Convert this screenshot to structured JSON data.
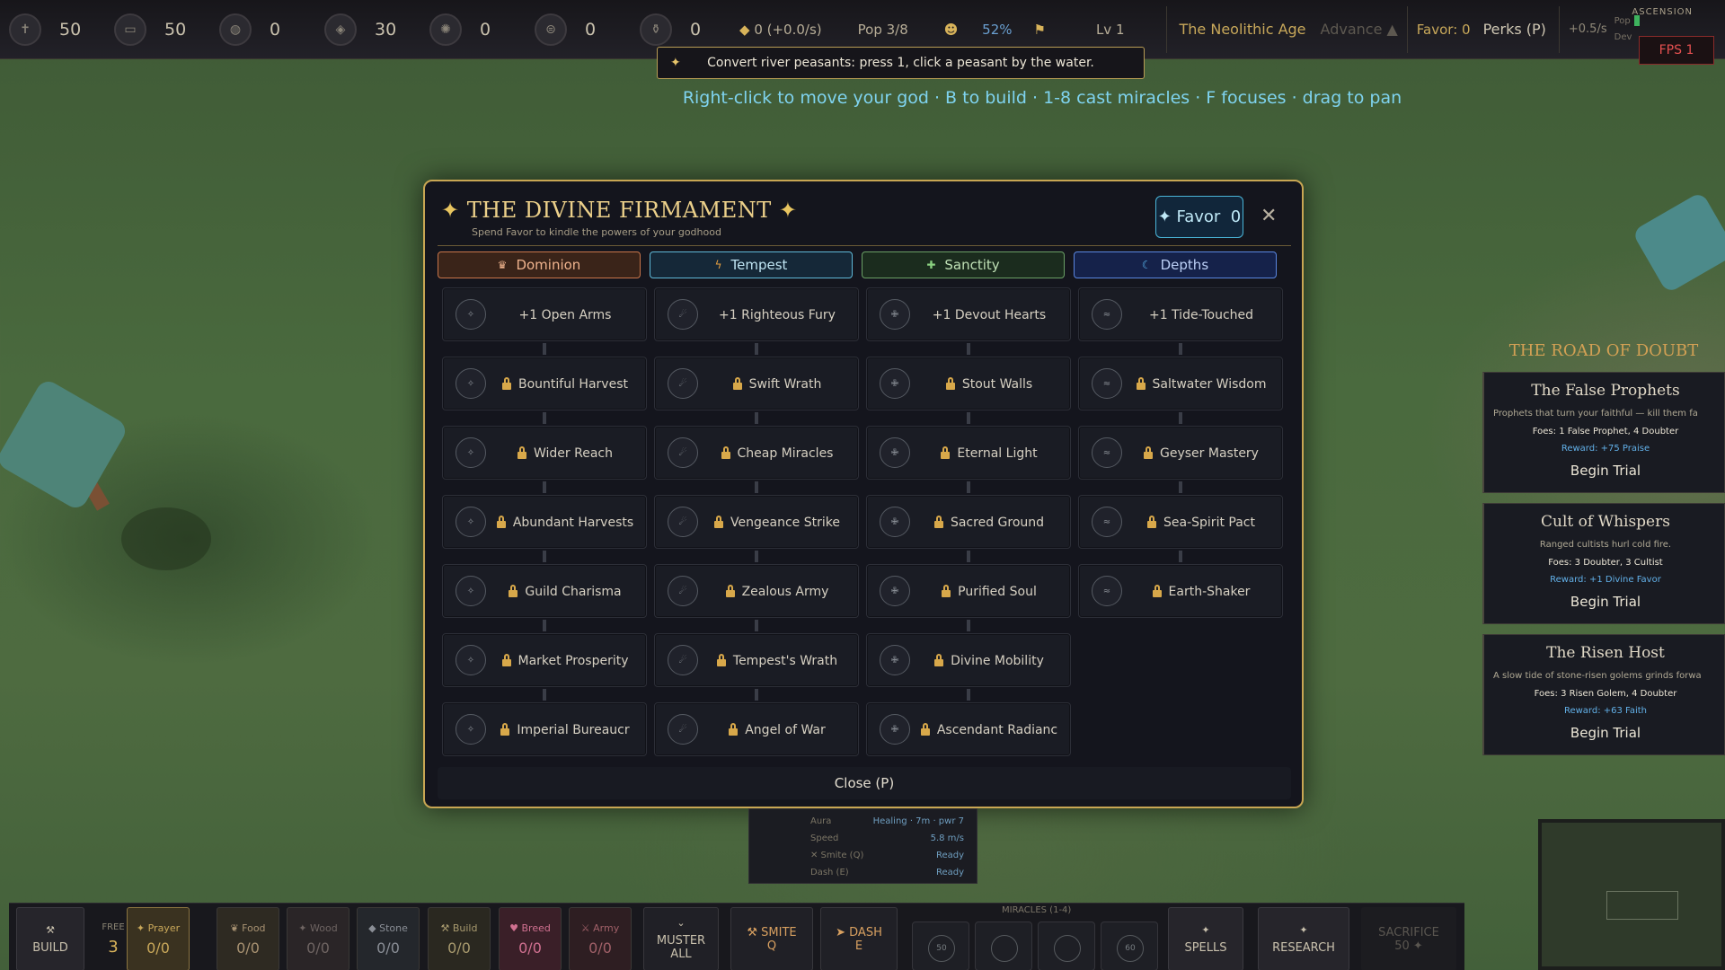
{
  "topbar": {
    "resources": [
      {
        "icon": "faith-icon",
        "value": "50"
      },
      {
        "icon": "food-icon",
        "value": "50"
      },
      {
        "icon": "wood-icon",
        "value": "0"
      },
      {
        "icon": "stone-icon",
        "value": "30"
      },
      {
        "icon": "ore-icon",
        "value": "0"
      },
      {
        "icon": "tools-icon",
        "value": "0"
      },
      {
        "icon": "relic-icon",
        "value": "0"
      }
    ],
    "gold": "0 (+0.0/s)",
    "pop": "Pop 3/8",
    "happiness": "52%",
    "level": "Lv 1",
    "age": "The Neolithic Age",
    "advance": "Advance ▲",
    "favor": "Favor: 0",
    "perks": "Perks (P)",
    "rate": "+0.5/s",
    "pop_label": "Pop",
    "dev_label": "Dev",
    "ascension": "ASCENSION",
    "fps": "FPS 1"
  },
  "objective": "Convert river peasants: press 1, click a peasant by the water.",
  "hint": "Right-click to move your god · B to build · 1-8 cast miracles · F focuses · drag to pan",
  "modal": {
    "title": "THE DIVINE FIRMAMENT",
    "subtitle": "Spend Favor to kindle the powers of your godhood",
    "favor_label": "✦ Favor",
    "favor_value": "0",
    "close_label": "Close (P)",
    "tabs": [
      "Dominion",
      "Tempest",
      "Sanctity",
      "Depths"
    ],
    "columns": [
      {
        "perks": [
          "+1  Open Arms",
          "Bountiful Harvest",
          "Wider Reach",
          "Abundant Harvests",
          "Guild Charisma",
          "Market Prosperity",
          "Imperial Bureaucr"
        ]
      },
      {
        "perks": [
          "+1  Righteous Fury",
          "Swift Wrath",
          "Cheap Miracles",
          "Vengeance Strike",
          "Zealous Army",
          "Tempest's Wrath",
          "Angel of War"
        ]
      },
      {
        "perks": [
          "+1  Devout Hearts",
          "Stout Walls",
          "Eternal Light",
          "Sacred Ground",
          "Purified Soul",
          "Divine Mobility",
          "Ascendant Radianc"
        ]
      },
      {
        "perks": [
          "+1  Tide-Touched",
          "Saltwater Wisdom",
          "Geyser Mastery",
          "Sea-Spirit Pact",
          "Earth-Shaker"
        ]
      }
    ]
  },
  "trials": {
    "heading": "THE ROAD OF DOUBT",
    "items": [
      {
        "title": "The False Prophets",
        "desc": "Prophets that turn your faithful — kill them fa",
        "foes": "Foes: 1 False Prophet, 4 Doubter",
        "reward": "Reward: +75 Praise",
        "button": "Begin Trial"
      },
      {
        "title": "Cult of Whispers",
        "desc": "Ranged cultists hurl cold fire.",
        "foes": "Foes: 3 Doubter, 3 Cultist",
        "reward": "Reward: +1 Divine Favor",
        "button": "Begin Trial"
      },
      {
        "title": "The Risen Host",
        "desc": "A slow tide of stone-risen golems grinds forwa",
        "foes": "Foes: 3 Risen Golem, 4 Doubter",
        "reward": "Reward: +63 Faith",
        "button": "Begin Trial"
      }
    ]
  },
  "stats": [
    {
      "k": "Aura",
      "v": "Healing · 7m · pwr 7"
    },
    {
      "k": "Speed",
      "v": "5.8 m/s"
    },
    {
      "k": "✕ Smite (Q)",
      "v": "Ready"
    },
    {
      "k": "Dash (E)",
      "v": "Ready"
    }
  ],
  "bottombar": {
    "build": "BUILD",
    "free_label": "FREE",
    "free_value": "3",
    "slots": [
      {
        "label": "✦ Prayer",
        "value": "0/0"
      },
      {
        "label": "❦ Food",
        "value": "0/0"
      },
      {
        "label": "✦ Wood",
        "value": "0/0"
      },
      {
        "label": "◆ Stone",
        "value": "0/0"
      },
      {
        "label": "⚒ Build",
        "value": "0/0"
      },
      {
        "label": "♥ Breed",
        "value": "0/0"
      },
      {
        "label": "⚔ Army",
        "value": "0/0"
      }
    ],
    "muster": "MUSTER ALL",
    "smite": "⚒ SMITE",
    "smite_key": "Q",
    "dash": "➤ DASH",
    "dash_key": "E",
    "miracles_label": "MIRACLES (1-4)",
    "miracles": [
      "50",
      "",
      "",
      "60"
    ],
    "spells": "SPELLS",
    "research": "RESEARCH",
    "sacrifice": "SACRIFICE",
    "sacrifice_cost": "50 ✦"
  }
}
